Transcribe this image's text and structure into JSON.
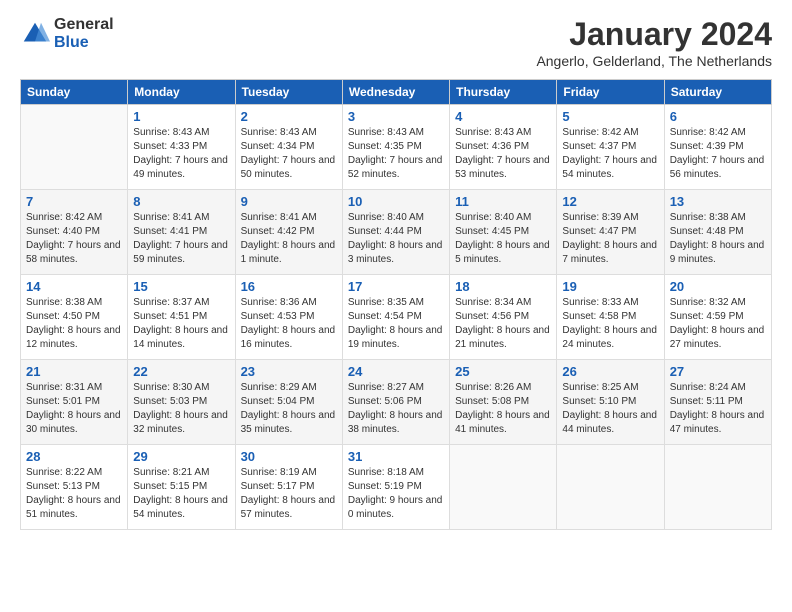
{
  "logo": {
    "general": "General",
    "blue": "Blue"
  },
  "header": {
    "month": "January 2024",
    "location": "Angerlo, Gelderland, The Netherlands"
  },
  "weekdays": [
    "Sunday",
    "Monday",
    "Tuesday",
    "Wednesday",
    "Thursday",
    "Friday",
    "Saturday"
  ],
  "weeks": [
    [
      {
        "day": "",
        "sunrise": "",
        "sunset": "",
        "daylight": ""
      },
      {
        "day": "1",
        "sunrise": "Sunrise: 8:43 AM",
        "sunset": "Sunset: 4:33 PM",
        "daylight": "Daylight: 7 hours and 49 minutes."
      },
      {
        "day": "2",
        "sunrise": "Sunrise: 8:43 AM",
        "sunset": "Sunset: 4:34 PM",
        "daylight": "Daylight: 7 hours and 50 minutes."
      },
      {
        "day": "3",
        "sunrise": "Sunrise: 8:43 AM",
        "sunset": "Sunset: 4:35 PM",
        "daylight": "Daylight: 7 hours and 52 minutes."
      },
      {
        "day": "4",
        "sunrise": "Sunrise: 8:43 AM",
        "sunset": "Sunset: 4:36 PM",
        "daylight": "Daylight: 7 hours and 53 minutes."
      },
      {
        "day": "5",
        "sunrise": "Sunrise: 8:42 AM",
        "sunset": "Sunset: 4:37 PM",
        "daylight": "Daylight: 7 hours and 54 minutes."
      },
      {
        "day": "6",
        "sunrise": "Sunrise: 8:42 AM",
        "sunset": "Sunset: 4:39 PM",
        "daylight": "Daylight: 7 hours and 56 minutes."
      }
    ],
    [
      {
        "day": "7",
        "sunrise": "Sunrise: 8:42 AM",
        "sunset": "Sunset: 4:40 PM",
        "daylight": "Daylight: 7 hours and 58 minutes."
      },
      {
        "day": "8",
        "sunrise": "Sunrise: 8:41 AM",
        "sunset": "Sunset: 4:41 PM",
        "daylight": "Daylight: 7 hours and 59 minutes."
      },
      {
        "day": "9",
        "sunrise": "Sunrise: 8:41 AM",
        "sunset": "Sunset: 4:42 PM",
        "daylight": "Daylight: 8 hours and 1 minute."
      },
      {
        "day": "10",
        "sunrise": "Sunrise: 8:40 AM",
        "sunset": "Sunset: 4:44 PM",
        "daylight": "Daylight: 8 hours and 3 minutes."
      },
      {
        "day": "11",
        "sunrise": "Sunrise: 8:40 AM",
        "sunset": "Sunset: 4:45 PM",
        "daylight": "Daylight: 8 hours and 5 minutes."
      },
      {
        "day": "12",
        "sunrise": "Sunrise: 8:39 AM",
        "sunset": "Sunset: 4:47 PM",
        "daylight": "Daylight: 8 hours and 7 minutes."
      },
      {
        "day": "13",
        "sunrise": "Sunrise: 8:38 AM",
        "sunset": "Sunset: 4:48 PM",
        "daylight": "Daylight: 8 hours and 9 minutes."
      }
    ],
    [
      {
        "day": "14",
        "sunrise": "Sunrise: 8:38 AM",
        "sunset": "Sunset: 4:50 PM",
        "daylight": "Daylight: 8 hours and 12 minutes."
      },
      {
        "day": "15",
        "sunrise": "Sunrise: 8:37 AM",
        "sunset": "Sunset: 4:51 PM",
        "daylight": "Daylight: 8 hours and 14 minutes."
      },
      {
        "day": "16",
        "sunrise": "Sunrise: 8:36 AM",
        "sunset": "Sunset: 4:53 PM",
        "daylight": "Daylight: 8 hours and 16 minutes."
      },
      {
        "day": "17",
        "sunrise": "Sunrise: 8:35 AM",
        "sunset": "Sunset: 4:54 PM",
        "daylight": "Daylight: 8 hours and 19 minutes."
      },
      {
        "day": "18",
        "sunrise": "Sunrise: 8:34 AM",
        "sunset": "Sunset: 4:56 PM",
        "daylight": "Daylight: 8 hours and 21 minutes."
      },
      {
        "day": "19",
        "sunrise": "Sunrise: 8:33 AM",
        "sunset": "Sunset: 4:58 PM",
        "daylight": "Daylight: 8 hours and 24 minutes."
      },
      {
        "day": "20",
        "sunrise": "Sunrise: 8:32 AM",
        "sunset": "Sunset: 4:59 PM",
        "daylight": "Daylight: 8 hours and 27 minutes."
      }
    ],
    [
      {
        "day": "21",
        "sunrise": "Sunrise: 8:31 AM",
        "sunset": "Sunset: 5:01 PM",
        "daylight": "Daylight: 8 hours and 30 minutes."
      },
      {
        "day": "22",
        "sunrise": "Sunrise: 8:30 AM",
        "sunset": "Sunset: 5:03 PM",
        "daylight": "Daylight: 8 hours and 32 minutes."
      },
      {
        "day": "23",
        "sunrise": "Sunrise: 8:29 AM",
        "sunset": "Sunset: 5:04 PM",
        "daylight": "Daylight: 8 hours and 35 minutes."
      },
      {
        "day": "24",
        "sunrise": "Sunrise: 8:27 AM",
        "sunset": "Sunset: 5:06 PM",
        "daylight": "Daylight: 8 hours and 38 minutes."
      },
      {
        "day": "25",
        "sunrise": "Sunrise: 8:26 AM",
        "sunset": "Sunset: 5:08 PM",
        "daylight": "Daylight: 8 hours and 41 minutes."
      },
      {
        "day": "26",
        "sunrise": "Sunrise: 8:25 AM",
        "sunset": "Sunset: 5:10 PM",
        "daylight": "Daylight: 8 hours and 44 minutes."
      },
      {
        "day": "27",
        "sunrise": "Sunrise: 8:24 AM",
        "sunset": "Sunset: 5:11 PM",
        "daylight": "Daylight: 8 hours and 47 minutes."
      }
    ],
    [
      {
        "day": "28",
        "sunrise": "Sunrise: 8:22 AM",
        "sunset": "Sunset: 5:13 PM",
        "daylight": "Daylight: 8 hours and 51 minutes."
      },
      {
        "day": "29",
        "sunrise": "Sunrise: 8:21 AM",
        "sunset": "Sunset: 5:15 PM",
        "daylight": "Daylight: 8 hours and 54 minutes."
      },
      {
        "day": "30",
        "sunrise": "Sunrise: 8:19 AM",
        "sunset": "Sunset: 5:17 PM",
        "daylight": "Daylight: 8 hours and 57 minutes."
      },
      {
        "day": "31",
        "sunrise": "Sunrise: 8:18 AM",
        "sunset": "Sunset: 5:19 PM",
        "daylight": "Daylight: 9 hours and 0 minutes."
      },
      {
        "day": "",
        "sunrise": "",
        "sunset": "",
        "daylight": ""
      },
      {
        "day": "",
        "sunrise": "",
        "sunset": "",
        "daylight": ""
      },
      {
        "day": "",
        "sunrise": "",
        "sunset": "",
        "daylight": ""
      }
    ]
  ]
}
